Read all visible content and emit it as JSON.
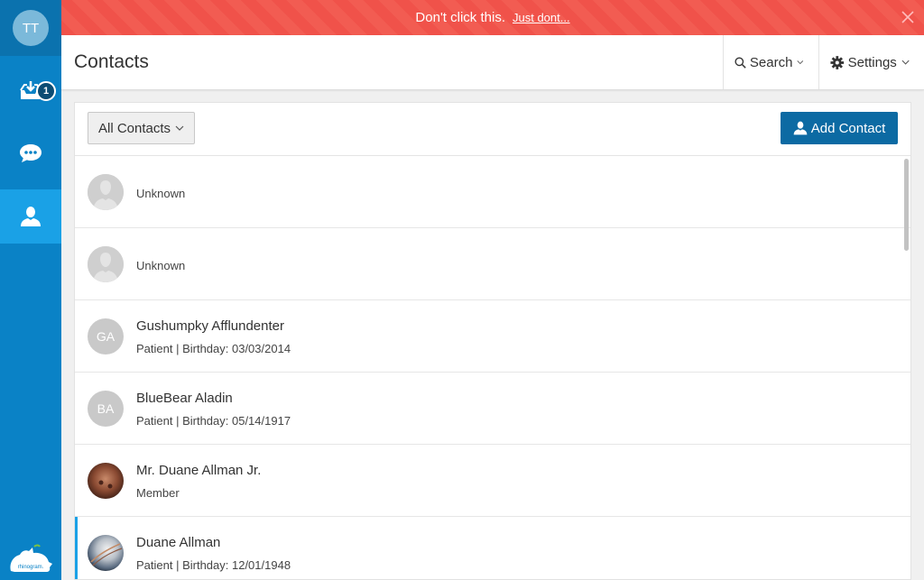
{
  "sidebar": {
    "user_initials": "TT",
    "inbox_badge": "1",
    "items": [
      {
        "name": "inbox",
        "icon": "inbox-download-icon"
      },
      {
        "name": "messages",
        "icon": "chat-bubble-icon"
      },
      {
        "name": "contacts",
        "icon": "user-icon",
        "active": true
      }
    ],
    "logo_text": "rhinogram."
  },
  "banner": {
    "text": "Don't click this.",
    "link": "Just dont...",
    "close_icon": "close-icon"
  },
  "header": {
    "title": "Contacts",
    "search_label": "Search",
    "settings_label": "Settings"
  },
  "toolbar": {
    "filter_label": "All Contacts",
    "add_label": "Add Contact"
  },
  "contacts": [
    {
      "name": "",
      "subtitle": "Unknown",
      "initials": "",
      "avatar": "placeholder"
    },
    {
      "name": "",
      "subtitle": "Unknown",
      "initials": "",
      "avatar": "placeholder"
    },
    {
      "name": "Gushumpky Afflundenter",
      "subtitle": "Patient | Birthday: 03/03/2014",
      "initials": "GA",
      "avatar": "initials"
    },
    {
      "name": "BlueBear Aladin",
      "subtitle": "Patient | Birthday: 05/14/1917",
      "initials": "BA",
      "avatar": "initials"
    },
    {
      "name": "Mr. Duane Allman Jr.",
      "subtitle": "Member",
      "initials": "",
      "avatar": "photo-brown"
    },
    {
      "name": "Duane Allman",
      "subtitle": "Patient | Birthday: 12/01/1948",
      "initials": "",
      "avatar": "photo-planet",
      "selected": true
    }
  ],
  "colors": {
    "sidebar": "#0a82c6",
    "sidebar_active": "#1aa1e6",
    "banner": "#f0524a",
    "primary_button": "#0c6aa3"
  }
}
